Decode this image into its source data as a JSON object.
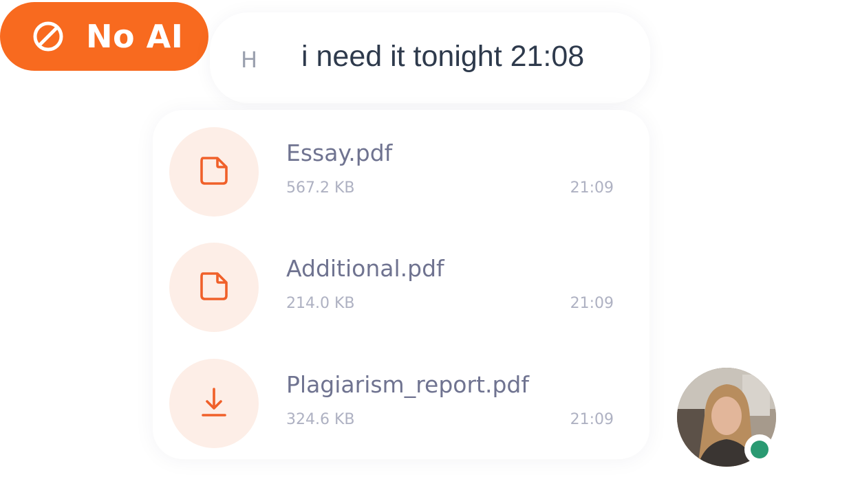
{
  "badge": {
    "label": "No AI",
    "icon": "no-entry-icon",
    "color": "#f86a1f"
  },
  "message": {
    "partial_text": "H",
    "text": "i need it tonight 21:08"
  },
  "files": [
    {
      "name": "Essay.pdf",
      "size": "567.2 KB",
      "time": "21:09",
      "icon": "document-icon"
    },
    {
      "name": "Additional.pdf",
      "size": "214.0 KB",
      "time": "21:09",
      "icon": "document-icon"
    },
    {
      "name": "Plagiarism_report.pdf",
      "size": "324.6 KB",
      "time": "21:09",
      "icon": "download-icon"
    }
  ],
  "avatar": {
    "status": "online",
    "status_color": "#2a9a72"
  },
  "colors": {
    "accent": "#f86a1f",
    "icon_bg": "#fdeee7",
    "file_name": "#6f7390",
    "meta": "#aeb1c2",
    "message_text": "#2e3a4c"
  }
}
